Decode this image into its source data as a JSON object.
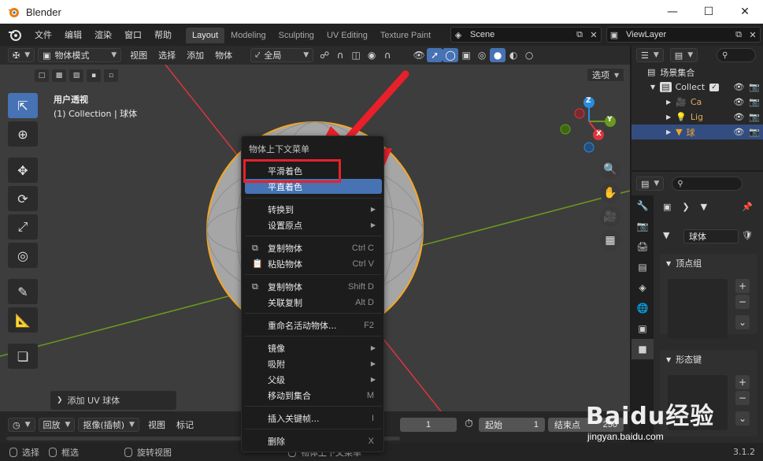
{
  "window": {
    "title": "Blender"
  },
  "menus": [
    "文件",
    "编辑",
    "渲染",
    "窗口",
    "帮助"
  ],
  "workspace_tabs": [
    "Layout",
    "Modeling",
    "Sculpting",
    "UV Editing",
    "Texture Paint"
  ],
  "active_workspace": "Layout",
  "scene": {
    "name": "Scene"
  },
  "view_layer": {
    "name": "ViewLayer"
  },
  "viewport_header": {
    "mode": "物体模式",
    "menus": [
      "视图",
      "选择",
      "添加",
      "物体"
    ],
    "transform_orientation": "全局",
    "options_label": "选项"
  },
  "viewport": {
    "view_name": "用户透视",
    "collection_info": "(1) Collection | 球体",
    "last_operator": "添加 UV 球体",
    "gizmo_axes": {
      "x": "X",
      "y": "Y",
      "z": "Z"
    },
    "colors": {
      "background": "#3d3d3d",
      "selection_outline": "#f5a623",
      "x_axis": "#d9363e",
      "y_axis": "#6a9a1f"
    }
  },
  "context_menu": {
    "title": "物体上下文菜单",
    "items": [
      {
        "label": "平滑着色",
        "shortcut": "",
        "submenu": false
      },
      {
        "label": "平直着色",
        "shortcut": "",
        "submenu": false,
        "highlighted": true
      },
      {
        "label": "转换到",
        "shortcut": "",
        "submenu": true
      },
      {
        "label": "设置原点",
        "shortcut": "",
        "submenu": true
      },
      {
        "label": "复制物体",
        "shortcut": "Ctrl C",
        "submenu": false
      },
      {
        "label": "粘贴物体",
        "shortcut": "Ctrl V",
        "submenu": false
      },
      {
        "label": "复制物体",
        "shortcut": "Shift D",
        "submenu": false
      },
      {
        "label": "关联复制",
        "shortcut": "Alt D",
        "submenu": false
      },
      {
        "label": "重命名活动物体...",
        "shortcut": "F2",
        "submenu": false
      },
      {
        "label": "镜像",
        "shortcut": "",
        "submenu": true
      },
      {
        "label": "吸附",
        "shortcut": "",
        "submenu": true
      },
      {
        "label": "父级",
        "shortcut": "",
        "submenu": true
      },
      {
        "label": "移动到集合",
        "shortcut": "M",
        "submenu": false
      },
      {
        "label": "插入关键帧...",
        "shortcut": "I",
        "submenu": false
      },
      {
        "label": "删除",
        "shortcut": "X",
        "submenu": false
      }
    ]
  },
  "timeline": {
    "playback": "回放",
    "keying": "抠像(插帧)",
    "view": "视图",
    "marker": "标记",
    "current_frame": "1",
    "start_label": "起始",
    "start_value": "1",
    "end_label": "结束点",
    "end_value": "250"
  },
  "statusbar": {
    "select": "选择",
    "box_select": "框选",
    "rotate_view": "旋转视图",
    "context_menu": "物体上下文菜单",
    "version": "3.1.2"
  },
  "outliner": {
    "root": "场景集合",
    "rows": [
      {
        "label": "Collect",
        "icon": "collection-icon",
        "selected": false
      },
      {
        "label": "Ca",
        "icon": "camera-icon",
        "selected": false
      },
      {
        "label": "Lig",
        "icon": "light-icon",
        "selected": false
      },
      {
        "label": "球",
        "icon": "mesh-icon",
        "selected": true
      }
    ]
  },
  "properties": {
    "object_name": "球体",
    "vertex_groups_title": "顶点组",
    "shape_keys_title": "形态键"
  },
  "watermark": {
    "main": "Baidu经验",
    "sub": "jingyan.baidu.com"
  }
}
